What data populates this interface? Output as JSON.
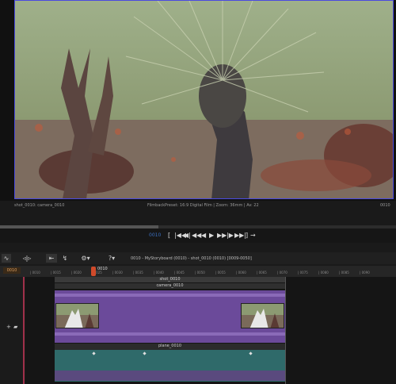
{
  "viewer": {
    "left_info": "shot_0010: camera_0010",
    "center_info": "FilmbackPreset: 16:9 Digital Film | Zoom: 36mm | Av: 22",
    "right_info": "0010"
  },
  "transport": {
    "frame_label": "0010",
    "buttons": [
      "[",
      "|◀◀",
      "◀|",
      "◀◀",
      "◀",
      "▶",
      "▶▶",
      "|▶",
      "▶▶|",
      "]",
      "→"
    ]
  },
  "timeline": {
    "sequence_title": "0010 - MyStoryboard (0010) - shot_0010 (0010) [0009-0050]",
    "start_frame": "0010",
    "playhead_frame": "0010",
    "ticks": [
      "0010",
      "0015",
      "0020",
      "0025",
      "0030",
      "0035",
      "0040",
      "0045",
      "0050",
      "0055",
      "0060",
      "0065",
      "0070",
      "0075",
      "0080",
      "0085",
      "0090"
    ],
    "shot_label": "shot_0010",
    "camera_label": "camera_0010",
    "plane_label": "plane_0010"
  },
  "colors": {
    "camera_clip": "#6b4a9a",
    "plane_clip": "#2f6a6a",
    "playhead": "#d04a2a"
  }
}
